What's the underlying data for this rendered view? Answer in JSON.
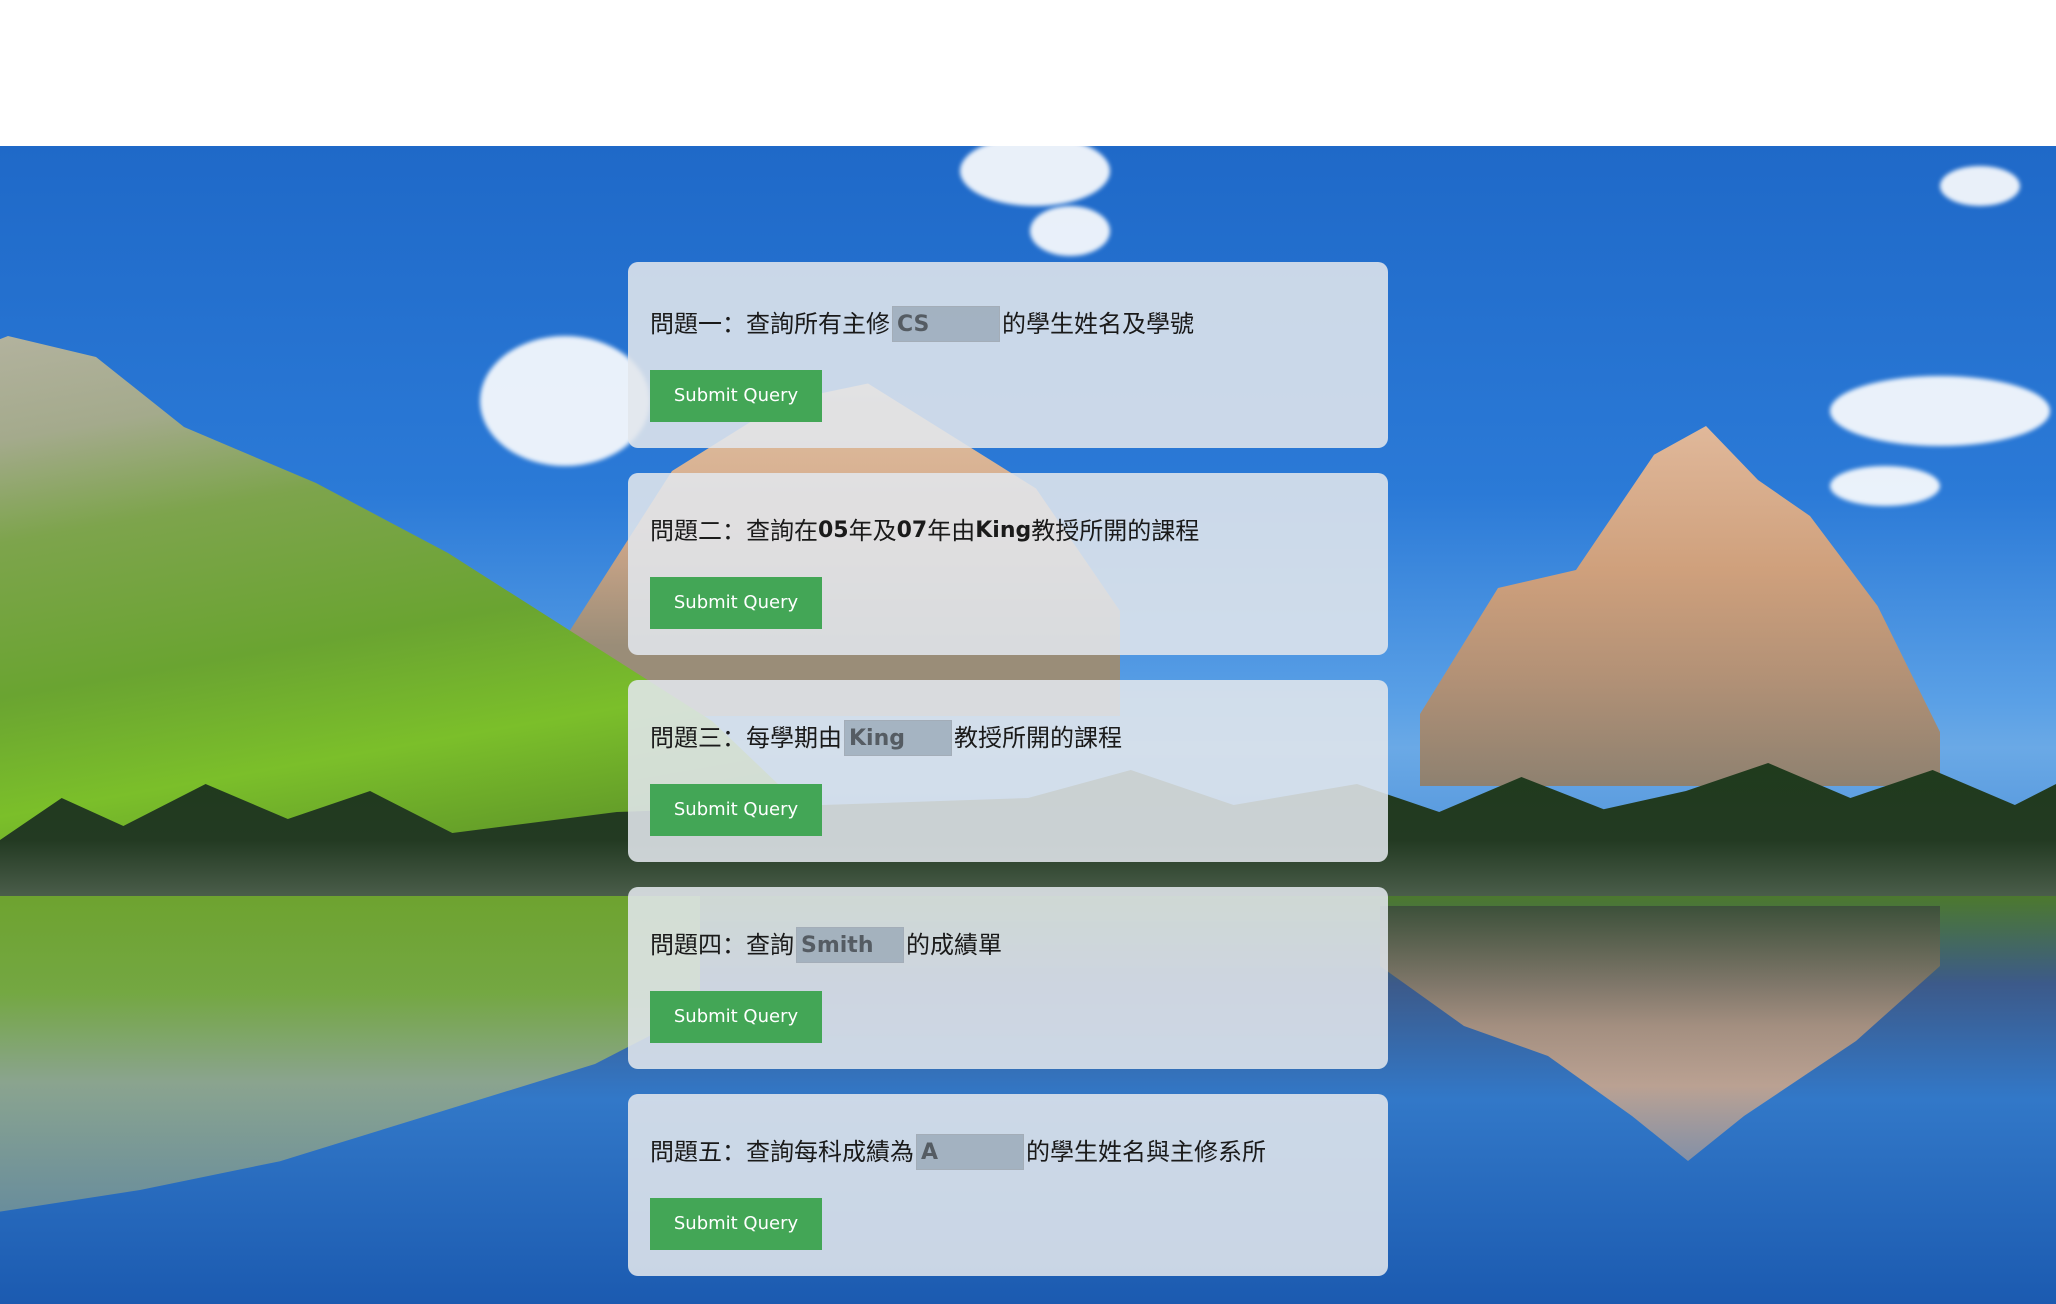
{
  "queries": [
    {
      "prefix": "問題一：查詢所有主修",
      "input_value": "CS",
      "suffix": "的學生姓名及學號",
      "submit_label": "Submit Query"
    },
    {
      "text_parts": [
        "問題二：查詢在",
        "05",
        "年及",
        "07",
        "年由",
        "King",
        "教授所開的課程"
      ],
      "submit_label": "Submit Query"
    },
    {
      "prefix": "問題三：每學期由",
      "input_value": "King",
      "suffix": "教授所開的課程",
      "submit_label": "Submit Query"
    },
    {
      "prefix": "問題四：查詢",
      "input_value": "Smith",
      "suffix": "的成績單",
      "submit_label": "Submit Query"
    },
    {
      "prefix": "問題五：查詢每科成績為",
      "input_value": "A",
      "suffix": "的學生姓名與主修系所",
      "submit_label": "Submit Query"
    }
  ],
  "colors": {
    "submit_bg": "#43a656",
    "card_bg": "rgba(225,230,236,0.88)"
  }
}
